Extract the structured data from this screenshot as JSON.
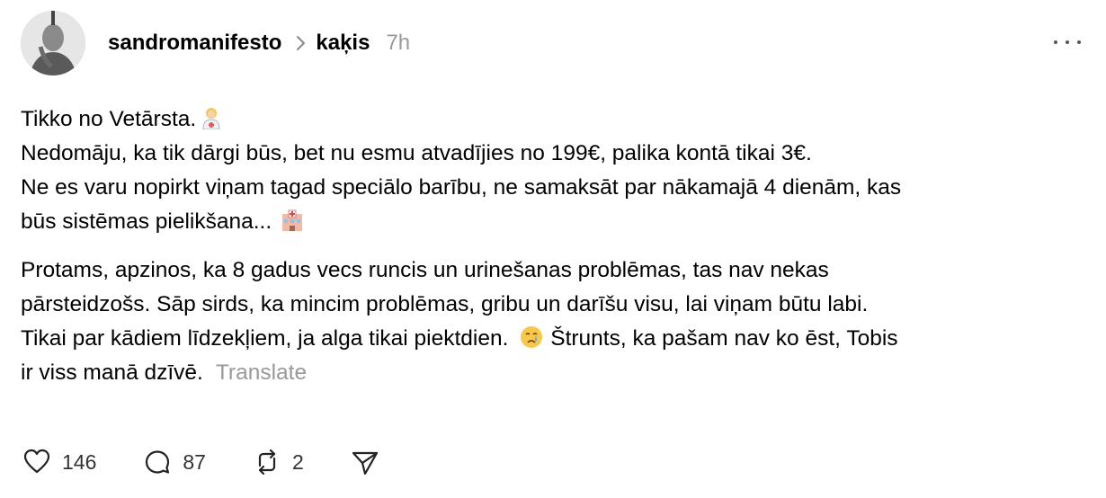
{
  "post": {
    "author": {
      "username": "sandromanifesto",
      "avatar_icon": "person-avatar"
    },
    "topic": "kaķis",
    "time_ago": "7h",
    "paragraph1": [
      "Tikko no Vetārsta.",
      "Nedomāju, ka tik dārgi būs, bet nu esmu atvadījies no 199€, palika kontā tikai 3€.",
      "Ne es varu nopirkt viņam tagad speciālo barību, ne samaksāt par nākamajā 4 dienām, kas",
      "būs sistēmas pielikšana..."
    ],
    "paragraph2": [
      "Protams, apzinos, ka 8 gadus vecs runcis un urinešanas problēmas, tas nav nekas",
      "pārsteidzošs. Sāp sirds, ka mincim problēmas, gribu un darīšu visu, lai viņam būtu labi.",
      "Tikai par kādiem līdzekļiem, ja alga tikai piektdien.",
      "Štrunts, ka pašam nav ko ēst, Tobis",
      "ir viss manā dzīvē."
    ],
    "translate_label": "Translate",
    "emojis": [
      "health-worker-emoji",
      "hospital-emoji",
      "crying-face-emoji"
    ]
  },
  "actions": {
    "likes": "146",
    "comments": "87",
    "reposts": "2"
  },
  "colors": {
    "text": "#000000",
    "muted": "#999999",
    "icon": "#333333"
  }
}
